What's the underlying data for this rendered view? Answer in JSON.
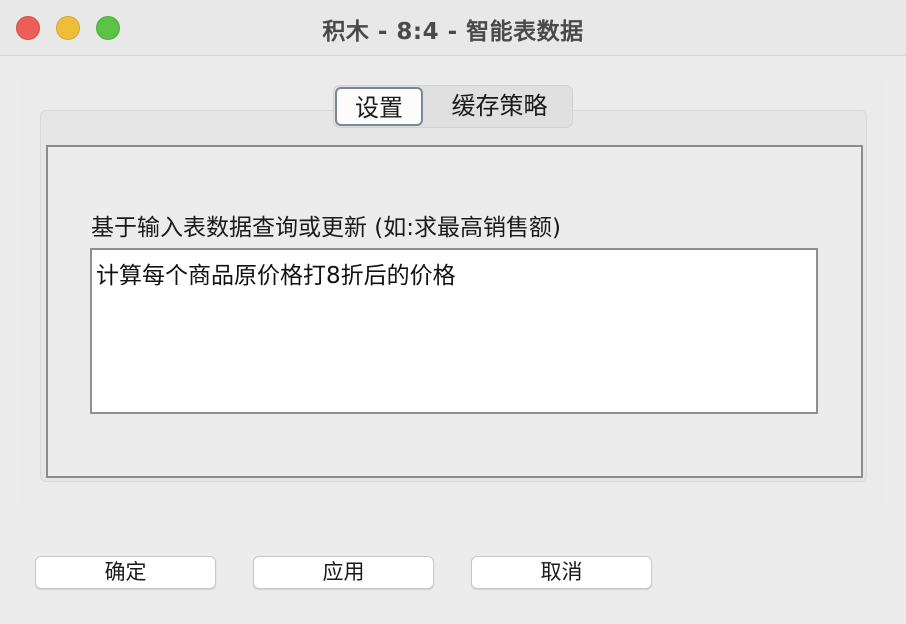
{
  "window": {
    "title": "积木 - 8:4 - 智能表数据"
  },
  "tabs": [
    {
      "label": "设置",
      "selected": true
    },
    {
      "label": "缓存策略",
      "selected": false
    }
  ],
  "settings": {
    "query_label": "基于输入表数据查询或更新 (如:求最高销售额)",
    "query_value": "计算每个商品原价格打8折后的价格"
  },
  "buttons": {
    "ok": "确定",
    "apply": "应用",
    "cancel": "取消"
  },
  "colors": {
    "close": "#ec5f56",
    "minimize": "#f0bd3a",
    "zoom": "#5dc346"
  }
}
